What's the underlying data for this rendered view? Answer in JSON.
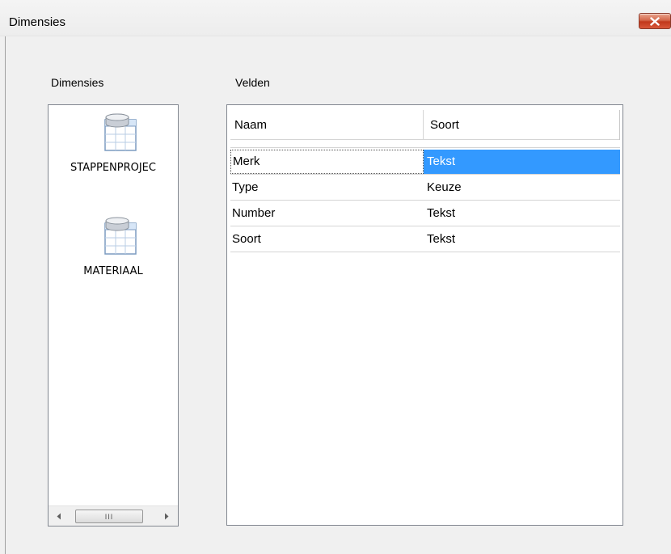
{
  "window": {
    "title": "Dimensies"
  },
  "labels": {
    "dimensions": "Dimensies",
    "fields": "Velden"
  },
  "dimensions": {
    "items": [
      {
        "name": "STAPPENPROJEC",
        "icon": "database-table-icon"
      },
      {
        "name": "MATERIAAL",
        "icon": "database-table-icon"
      }
    ],
    "scrollbar_thumb_grip": "III"
  },
  "fields": {
    "columns": [
      "Naam",
      "Soort"
    ],
    "rows": [
      {
        "naam": "Merk",
        "soort": "Tekst",
        "selected": true
      },
      {
        "naam": "Type",
        "soort": "Keuze",
        "selected": false
      },
      {
        "naam": "Number",
        "soort": "Tekst",
        "selected": false
      },
      {
        "naam": "Soort",
        "soort": "Tekst",
        "selected": false
      }
    ]
  },
  "colors": {
    "selection": "#3399ff",
    "close_button": "#c1391c",
    "border": "#828790"
  }
}
